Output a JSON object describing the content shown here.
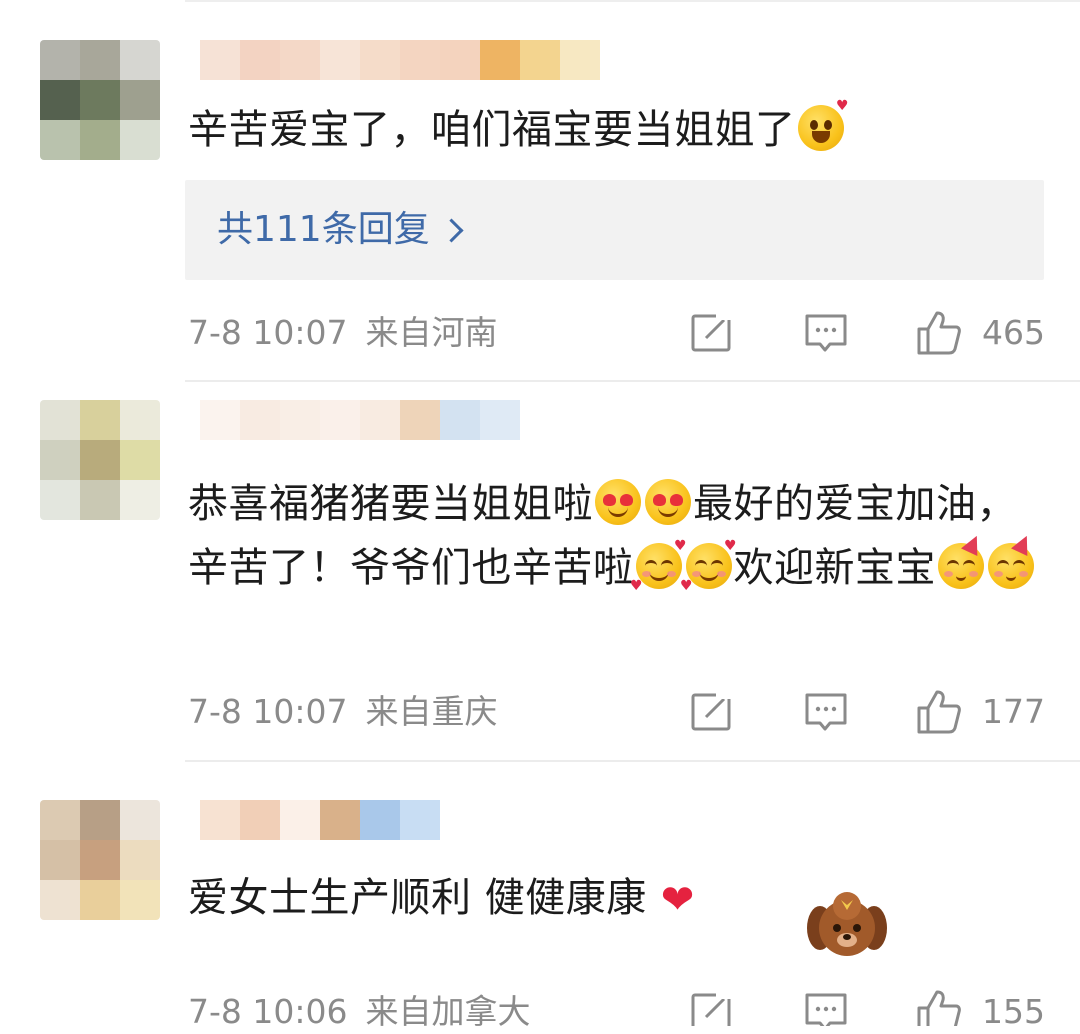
{
  "comments": [
    {
      "text": "辛苦爱宝了，咱们福宝要当姐姐了",
      "replies_label": "共111条回复",
      "time": "7-8 10:07",
      "location": "来自河南",
      "likes": "465",
      "emojis": [
        "laugh-emoji"
      ]
    },
    {
      "text_part1": "恭喜福猪猪要当姐姐啦",
      "text_part2": "最好的爱宝加油，辛苦了！爷爷们也辛苦啦",
      "text_part3": "欢迎新宝宝",
      "time": "7-8 10:07",
      "location": "来自重庆",
      "likes": "177",
      "emojis": [
        "heart-eyes-emoji",
        "heart-eyes-emoji",
        "smiling-hearts-emoji",
        "smiling-hearts-emoji",
        "party-emoji",
        "party-emoji"
      ]
    },
    {
      "text": "爱女士生产顺利 健健康康",
      "time": "7-8 10:06",
      "location": "来自加拿大",
      "likes": "155",
      "emojis": [
        "red-heart-icon",
        "puppy-sticker"
      ]
    }
  ],
  "icons": {
    "repost": "repost-icon",
    "comment": "comment-icon",
    "like": "thumbs-up-icon"
  },
  "colors": {
    "link": "#3f6aa8",
    "meta": "#8a8a8a",
    "reply_box_bg": "#f2f2f2",
    "heart": "#e5223f"
  },
  "avatars": [
    [
      "#b3b3ab",
      "#a8a79a",
      "#d6d6d1",
      "#55614f",
      "#6d7a5e",
      "#9ea08f",
      "#b9c2ad",
      "#a3ad8c",
      "#d9ded2"
    ],
    [
      "#e2e2d6",
      "#d8d09c",
      "#ebeadb",
      "#cfd0bf",
      "#b8ab7c",
      "#dedca6",
      "#e3e6de",
      "#c9c8b3",
      "#eeeee4"
    ],
    [
      "#dccab2",
      "#b79f86",
      "#ece5dc",
      "#d5c0a6",
      "#c7a07f",
      "#ecdcbf",
      "#eee2d2",
      "#e9cf9b",
      "#f2e3b9"
    ]
  ],
  "usernames": [
    [
      "#f6e2d6",
      "#f3d3c2",
      "#f4d8c7",
      "#f7e4d7",
      "#f5dcc9",
      "#f4d5c1",
      "#f4d3be",
      "#eeb463",
      "#f3d48f",
      "#f7e8c2"
    ],
    [
      "#fbf3ee",
      "#f8ebe2",
      "#f9eee6",
      "#faf0ea",
      "#f8ebe1",
      "#eed4b9",
      "#d3e2f1",
      "#dfeaf5"
    ],
    [
      "#f7e2d2",
      "#f1cfb7",
      "#fbf0e8",
      "#d9b18a",
      "#a9c8ea",
      "#c8ddf3"
    ]
  ]
}
